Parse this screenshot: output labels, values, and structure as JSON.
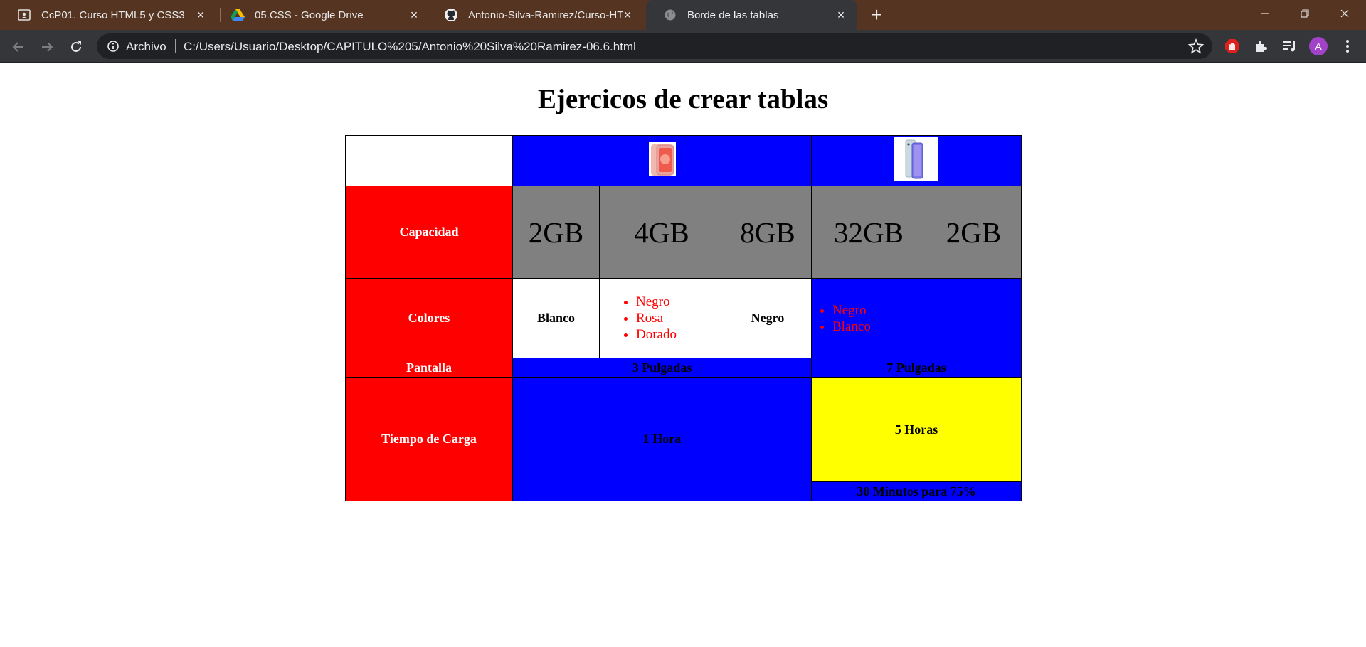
{
  "browser": {
    "tabs": [
      {
        "title": "CcP01. Curso HTML5 y CSS3",
        "icon": "classroom-icon"
      },
      {
        "title": "05.CSS - Google Drive",
        "icon": "google-drive-icon"
      },
      {
        "title": "Antonio-Silva-Ramirez/Curso-HT",
        "icon": "github-icon"
      },
      {
        "title": "Borde de las tablas",
        "icon": "globe-icon"
      }
    ],
    "address_scheme": "Archivo",
    "address_url": "C:/Users/Usuario/Desktop/CAPITULO%205/Antonio%20Silva%20Ramirez-06.6.html",
    "avatar_letter": "A"
  },
  "page": {
    "heading": "Ejercicos de crear tablas",
    "rows": {
      "capacidad": {
        "label": "Capacidad",
        "values": [
          "2GB",
          "4GB",
          "8GB",
          "32GB",
          "2GB"
        ]
      },
      "colores": {
        "label": "Colores",
        "phone1_a": "Blanco",
        "phone1_b_list": [
          "Negro",
          "Rosa",
          "Dorado"
        ],
        "phone1_c": "Negro",
        "phone2_list": [
          "Negro",
          "Blanco"
        ]
      },
      "pantalla": {
        "label": "Pantalla",
        "phone1": "3 Pulgadas",
        "phone2": "7 Pulgadas"
      },
      "carga": {
        "label": "Tiempo de Carga",
        "phone1": "1 Hora",
        "phone2": "5 Horas",
        "phone2_note": "30 Minutos para 75%"
      }
    }
  },
  "colors": {
    "header_cell": "#0000ff",
    "label_cell": "#ff0000",
    "capacity_cell": "#808080",
    "highlight_cell": "#ffff00"
  }
}
